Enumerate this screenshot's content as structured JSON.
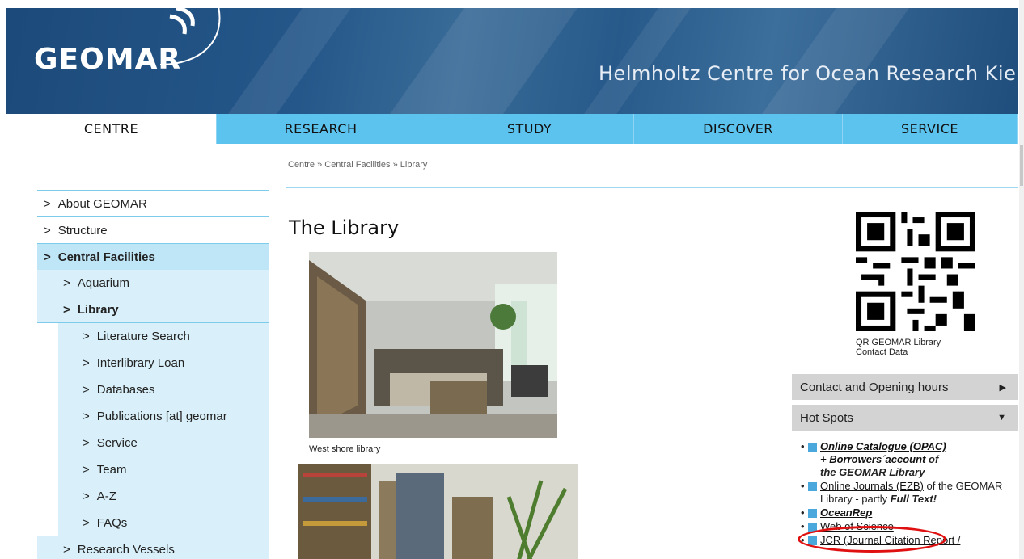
{
  "header": {
    "logo": "GEOMAR",
    "tagline": "Helmholtz Centre for Ocean Research Kie"
  },
  "nav": [
    "CENTRE",
    "RESEARCH",
    "STUDY",
    "DISCOVER",
    "SERVICE"
  ],
  "breadcrumb": "Centre » Central Facilities » Library",
  "sidebar": {
    "items": [
      {
        "label": "About GEOMAR",
        "level": 0
      },
      {
        "label": "Structure",
        "level": 0
      },
      {
        "label": "Central Facilities",
        "level": 0,
        "active": true
      },
      {
        "label": "Aquarium",
        "level": 1
      },
      {
        "label": "Library",
        "level": 1,
        "active": true
      },
      {
        "label": "Literature Search",
        "level": 2
      },
      {
        "label": "Interlibrary Loan",
        "level": 2
      },
      {
        "label": "Databases",
        "level": 2
      },
      {
        "label": "Publications [at] geomar",
        "level": 2
      },
      {
        "label": "Service",
        "level": 2
      },
      {
        "label": "Team",
        "level": 2
      },
      {
        "label": "A-Z",
        "level": 2
      },
      {
        "label": "FAQs",
        "level": 2
      },
      {
        "label": "Research Vessels",
        "level": 1
      }
    ]
  },
  "main": {
    "title": "The Library",
    "caption": "West shore library"
  },
  "right": {
    "qr_caption_1": "QR GEOMAR Library",
    "qr_caption_2": "Contact Data",
    "accordion_contact": "Contact and Opening hours",
    "accordion_hotspots": "Hot Spots",
    "hotspots": {
      "opac_link": "Online Catalogue (OPAC)",
      "borrowers_link": "+ Borrowers´account",
      "of": " of",
      "geomar_library": "the GEOMAR Library",
      "ezb_link": "Online Journals (EZB)",
      "ezb_text": " of the GEOMAR Library - partly ",
      "full_text": "Full Text!",
      "oceanrep": "OceanRep",
      "wos": "Web of Science",
      "jcr": "JCR (Journal Citation Report /"
    }
  },
  "colors": {
    "header_blue": "#25578a",
    "nav_blue": "#5bc3ee",
    "sidebar_light": "#d9f0fa",
    "sidebar_active": "#bfe6f7",
    "highlight_red": "#e01010"
  }
}
